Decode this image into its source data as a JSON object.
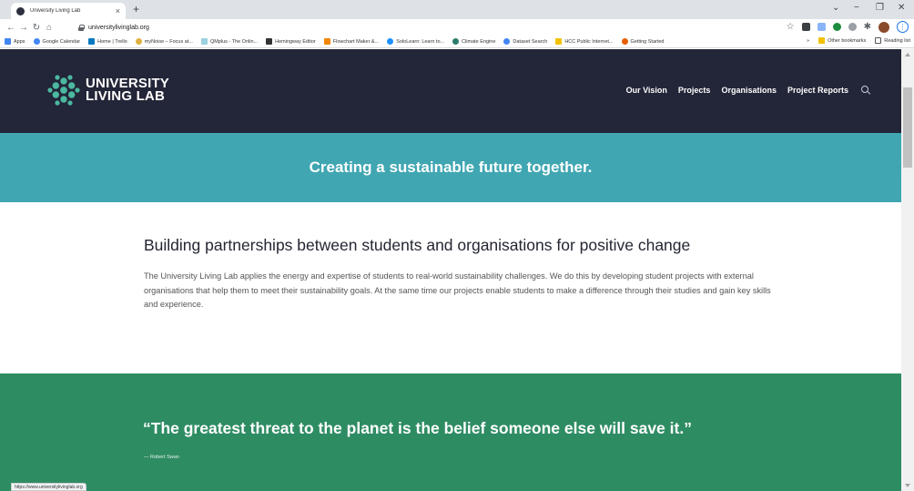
{
  "browser": {
    "tab_title": "University Living Lab",
    "url": "universitylivinglab.org",
    "new_tab": "+",
    "tab_close": "×",
    "win_min": "−",
    "win_max": "❐",
    "win_close": "✕",
    "win_dropdown": "⌄",
    "status_url": "https://www.universitylivinglab.org",
    "bookmarks": [
      {
        "label": "Apps",
        "icon": "apps-grid-icon",
        "color": "#4285f4"
      },
      {
        "label": "Google Calendar",
        "icon": "google-icon",
        "color": "#4285f4"
      },
      {
        "label": "Home | Trello",
        "icon": "trello-icon",
        "color": "#0079bf"
      },
      {
        "label": "myNoise – Focus at...",
        "icon": "mynoise-icon",
        "color": "#e0b040"
      },
      {
        "label": "QMplus - The Onlin...",
        "icon": "qmplus-icon",
        "color": "#9bd0e0"
      },
      {
        "label": "Hemingway Editor",
        "icon": "hemingway-icon",
        "color": "#333333"
      },
      {
        "label": "Flowchart Maker &...",
        "icon": "drawio-icon",
        "color": "#f08705"
      },
      {
        "label": "SoloLearn: Learn to...",
        "icon": "sololearn-icon",
        "color": "#1e90ff"
      },
      {
        "label": "Climate Engine",
        "icon": "climate-engine-icon",
        "color": "#2a7d6b"
      },
      {
        "label": "Dataset Search",
        "icon": "google-icon",
        "color": "#4285f4"
      },
      {
        "label": "HCC Public Internet...",
        "icon": "hcc-icon",
        "color": "#f2c200"
      },
      {
        "label": "Getting Started",
        "icon": "firefox-icon",
        "color": "#e66000"
      }
    ],
    "bookmarks_overflow": "»",
    "other_bookmarks": "Other bookmarks",
    "reading_list": "Reading list"
  },
  "site": {
    "logo_line1": "UNIVERSITY",
    "logo_line2": "LIVING LAB",
    "nav": [
      "Our Vision",
      "Projects",
      "Organisations",
      "Project Reports"
    ],
    "tagline": "Creating a sustainable future together.",
    "intro_heading": "Building partnerships between students and organisations for positive change",
    "intro_body": "The University Living Lab applies the energy and expertise of students to real-world sustainability challenges. We do this by developing student projects with external organisations that help them to meet their sustainability goals. At the same time our projects enable students to make a difference through their studies and gain key skills and experience.",
    "quote": "“The greatest threat to the planet is the belief someone else will save it.”",
    "quote_author": "— Robert Swan"
  },
  "colors": {
    "header_bg": "#232538",
    "tagline_bg": "#40a6b2",
    "quote_bg": "#2e8c63",
    "logo_mark": "#4bb8a0"
  }
}
